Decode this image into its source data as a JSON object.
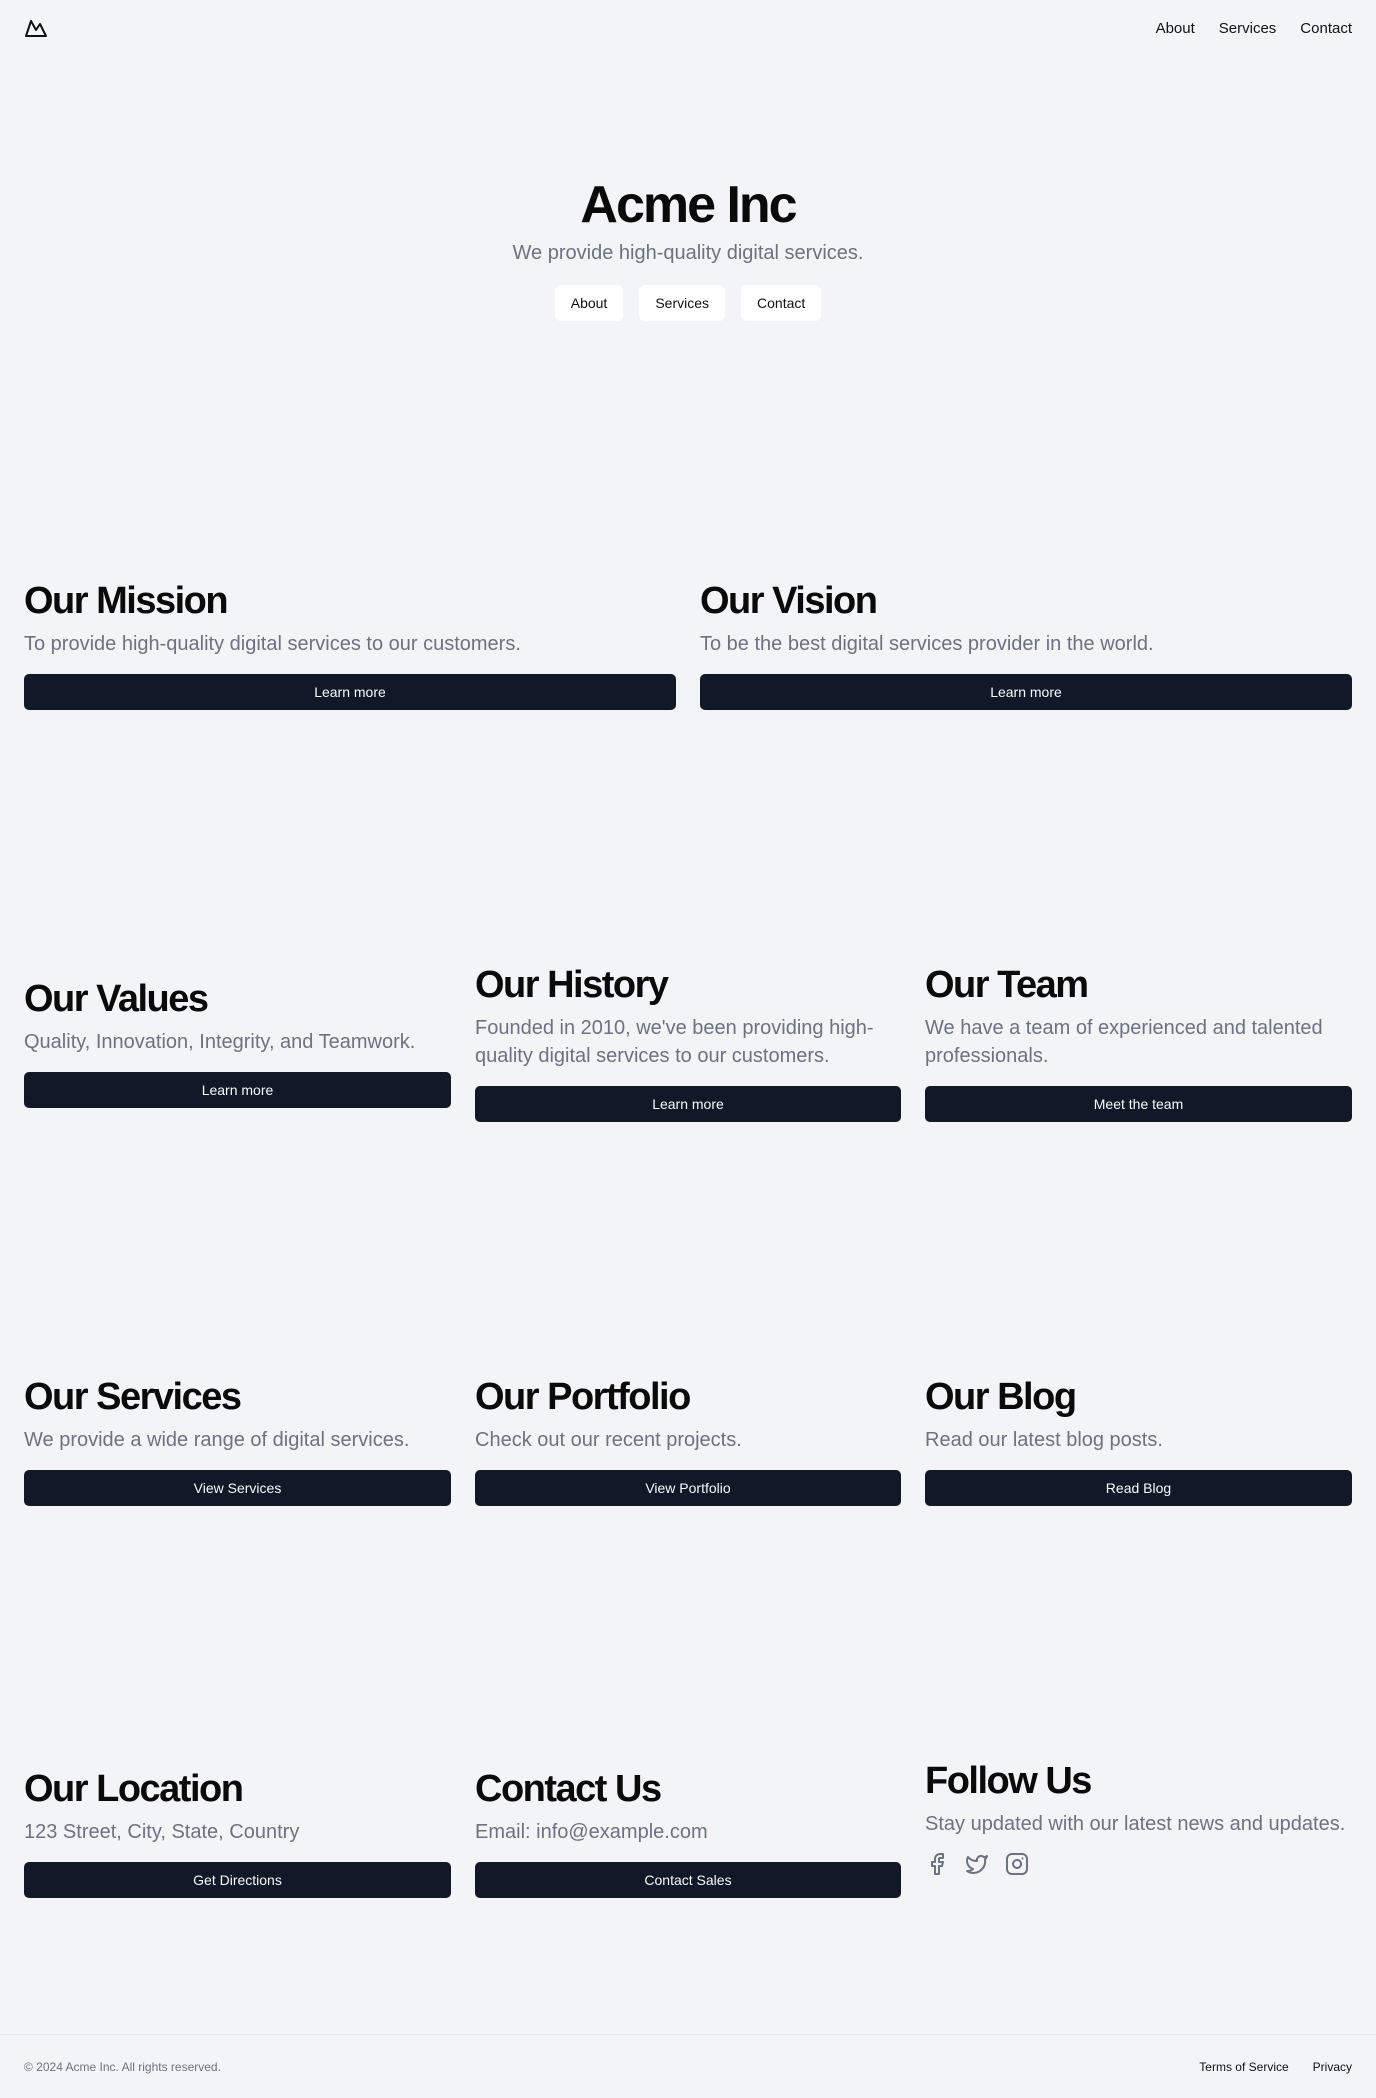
{
  "nav": {
    "logo_icon": "mountain-icon",
    "links": [
      "About",
      "Services",
      "Contact"
    ]
  },
  "hero": {
    "title": "Acme Inc",
    "subtitle": "We provide high-quality digital services.",
    "buttons": [
      "About",
      "Services",
      "Contact"
    ]
  },
  "sections": {
    "mission": {
      "title": "Our Mission",
      "text": "To provide high-quality digital services to our customers.",
      "button": "Learn more"
    },
    "vision": {
      "title": "Our Vision",
      "text": "To be the best digital services provider in the world.",
      "button": "Learn more"
    },
    "values": {
      "title": "Our Values",
      "text": "Quality, Innovation, Integrity, and Teamwork.",
      "button": "Learn more"
    },
    "history": {
      "title": "Our History",
      "text": "Founded in 2010, we've been providing high-quality digital services to our customers.",
      "button": "Learn more"
    },
    "team": {
      "title": "Our Team",
      "text": "We have a team of experienced and talented professionals.",
      "button": "Meet the team"
    },
    "services": {
      "title": "Our Services",
      "text": "We provide a wide range of digital services.",
      "button": "View Services"
    },
    "portfolio": {
      "title": "Our Portfolio",
      "text": "Check out our recent projects.",
      "button": "View Portfolio"
    },
    "blog": {
      "title": "Our Blog",
      "text": "Read our latest blog posts.",
      "button": "Read Blog"
    },
    "location": {
      "title": "Our Location",
      "text": "123 Street, City, State, Country",
      "button": "Get Directions"
    },
    "contact": {
      "title": "Contact Us",
      "text": "Email: info@example.com",
      "button": "Contact Sales"
    },
    "follow": {
      "title": "Follow Us",
      "text": "Stay updated with our latest news and updates.",
      "icons": [
        "facebook-icon",
        "twitter-icon",
        "instagram-icon"
      ]
    }
  },
  "footer": {
    "copyright": "© 2024 Acme Inc. All rights reserved.",
    "links": [
      "Terms of Service",
      "Privacy"
    ]
  },
  "colors": {
    "background": "#f3f4f6",
    "primary_button": "#111827",
    "muted_text": "#6b7280"
  }
}
